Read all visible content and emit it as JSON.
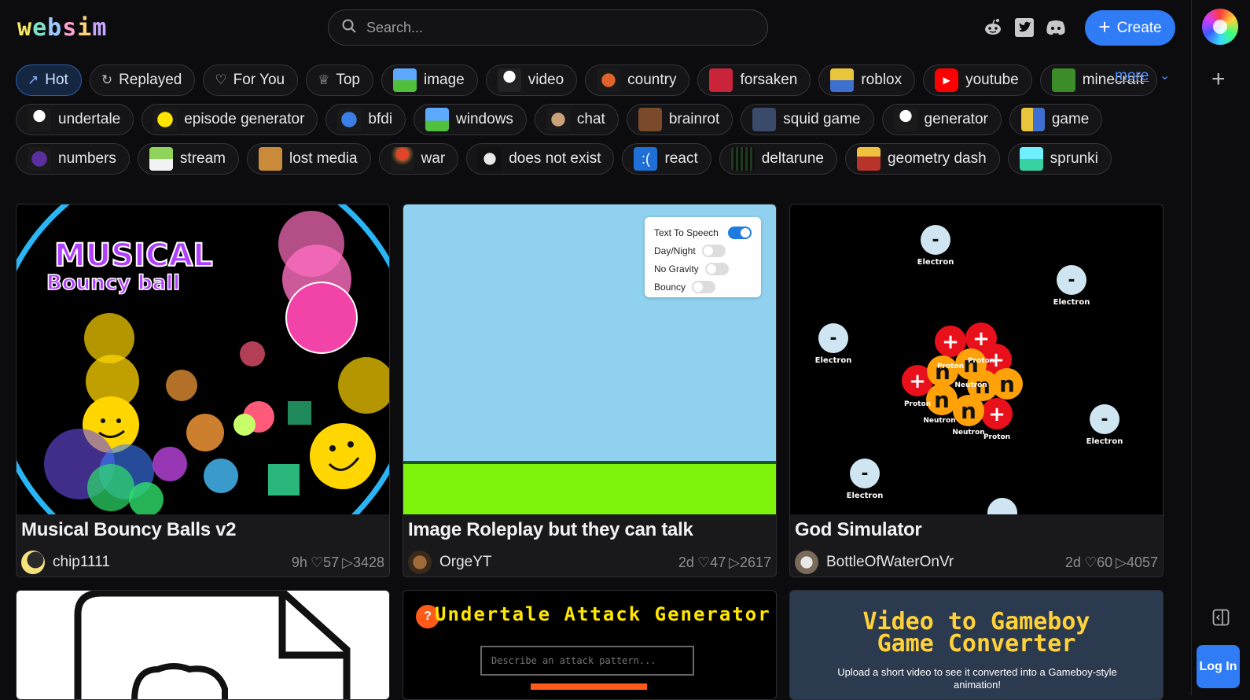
{
  "header": {
    "logo_letters": [
      "w",
      "e",
      "b",
      "s",
      "i",
      "m"
    ],
    "search_placeholder": "Search...",
    "create_label": "Create"
  },
  "tags": {
    "row1": [
      "Hot",
      "Replayed",
      "For You",
      "Top",
      "image",
      "video",
      "country",
      "forsaken",
      "roblox",
      "youtube",
      "minecraft"
    ],
    "row2": [
      "undertale",
      "episode generator",
      "bfdi",
      "windows",
      "chat",
      "brainrot",
      "squid game",
      "generator",
      "game"
    ],
    "row3": [
      "numbers",
      "stream",
      "lost media",
      "war",
      "does not exist",
      "react",
      "deltarune",
      "geometry dash",
      "sprunki"
    ],
    "more_label": "more"
  },
  "cards": [
    {
      "title": "Musical Bouncy Balls v2",
      "author": "chip1111",
      "age": "9h",
      "likes": "♡57",
      "plays": "▷3428",
      "thumb_text_line1": "MUSICAL",
      "thumb_text_line2": "Bouncy ball"
    },
    {
      "title": "Image Roleplay but they can talk",
      "author": "OrgeYT",
      "age": "2d",
      "likes": "♡47",
      "plays": "▷2617",
      "settings": [
        "Text To Speech",
        "Day/Night",
        "No Gravity",
        "Bouncy"
      ],
      "settings_on": [
        true,
        false,
        false,
        false
      ]
    },
    {
      "title": "God Simulator",
      "author": "BottleOfWaterOnVr",
      "age": "2d",
      "likes": "♡60",
      "plays": "▷4057",
      "electron_label": "Electron",
      "proton_label": "Proton",
      "neutron_label": "Neutron"
    }
  ],
  "cards_row2": {
    "undertale_title": "Undertale Attack Generator",
    "undertale_placeholder": "Describe an attack pattern...",
    "gameboy_title_1": "Video to Gameboy",
    "gameboy_title_2": "Game Converter",
    "gameboy_sub": "Upload a short video to see it converted into a Gameboy-style animation!"
  },
  "rail": {
    "login_label": "Log In"
  },
  "colors": {
    "accent": "#2f7cf6",
    "background": "#0c0c0e"
  }
}
